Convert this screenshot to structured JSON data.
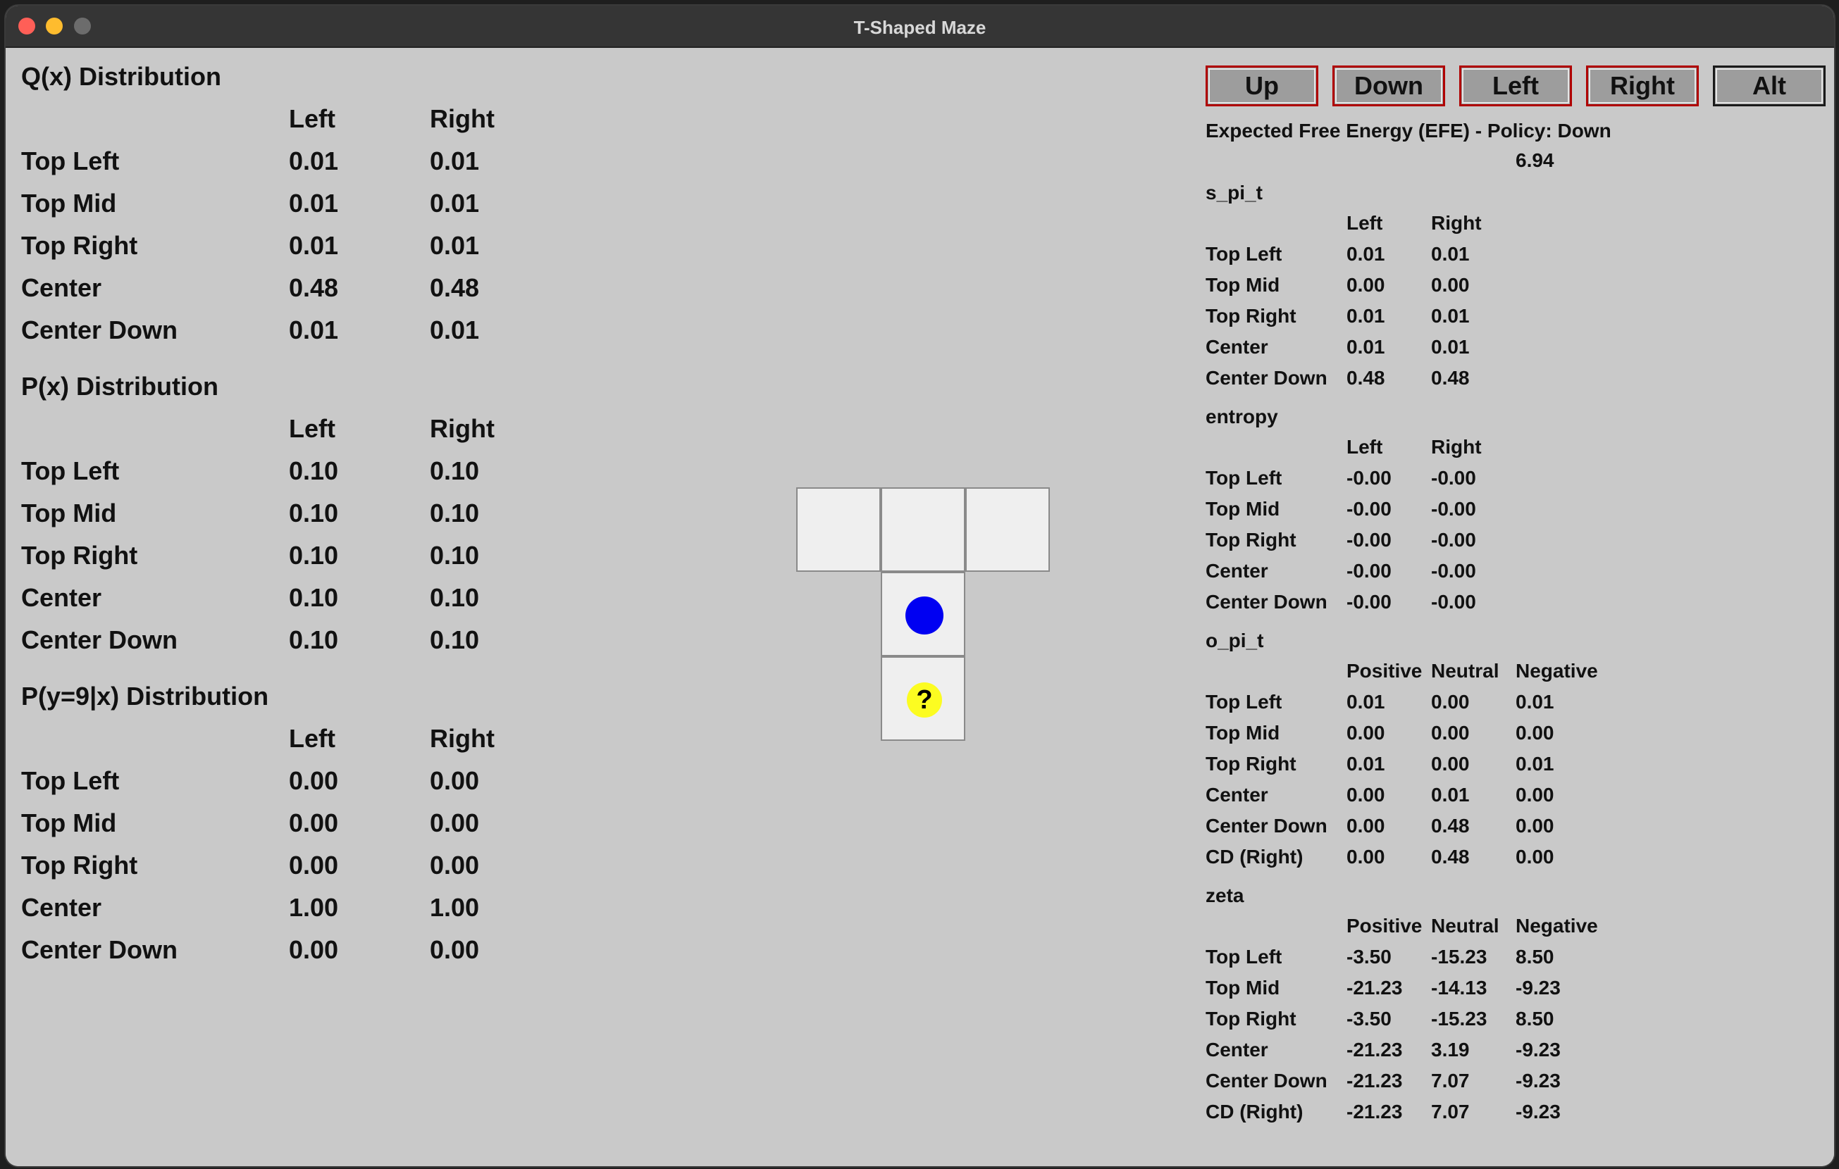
{
  "window": {
    "title": "T-Shaped Maze"
  },
  "left": {
    "tables": [
      {
        "title": "Q(x) Distribution",
        "headers": [
          "Left",
          "Right"
        ],
        "rows": [
          {
            "label": "Top Left",
            "left": "0.01",
            "right": "0.01"
          },
          {
            "label": "Top Mid",
            "left": "0.01",
            "right": "0.01"
          },
          {
            "label": "Top Right",
            "left": "0.01",
            "right": "0.01"
          },
          {
            "label": "Center",
            "left": "0.48",
            "right": "0.48"
          },
          {
            "label": "Center Down",
            "left": "0.01",
            "right": "0.01"
          }
        ]
      },
      {
        "title": "P(x) Distribution",
        "headers": [
          "Left",
          "Right"
        ],
        "rows": [
          {
            "label": "Top Left",
            "left": "0.10",
            "right": "0.10"
          },
          {
            "label": "Top Mid",
            "left": "0.10",
            "right": "0.10"
          },
          {
            "label": "Top Right",
            "left": "0.10",
            "right": "0.10"
          },
          {
            "label": "Center",
            "left": "0.10",
            "right": "0.10"
          },
          {
            "label": "Center Down",
            "left": "0.10",
            "right": "0.10"
          }
        ]
      },
      {
        "title": "P(y=9|x) Distribution",
        "headers": [
          "Left",
          "Right"
        ],
        "rows": [
          {
            "label": "Top Left",
            "left": "0.00",
            "right": "0.00"
          },
          {
            "label": "Top Mid",
            "left": "0.00",
            "right": "0.00"
          },
          {
            "label": "Top Right",
            "left": "0.00",
            "right": "0.00"
          },
          {
            "label": "Center",
            "left": "1.00",
            "right": "1.00"
          },
          {
            "label": "Center Down",
            "left": "0.00",
            "right": "0.00"
          }
        ]
      }
    ]
  },
  "maze": {
    "unknown_marker": "?"
  },
  "buttons": [
    "Up",
    "Down",
    "Left",
    "Right",
    "Alt"
  ],
  "right": {
    "efe_title": "Expected Free Energy (EFE) - Policy: Down",
    "efe_value": "6.94",
    "sections": [
      {
        "title": "s_pi_t",
        "headers": [
          "Left",
          "Right"
        ],
        "rows": [
          {
            "label": "Top Left",
            "vals": [
              "0.01",
              "0.01"
            ]
          },
          {
            "label": "Top Mid",
            "vals": [
              "0.00",
              "0.00"
            ]
          },
          {
            "label": "Top Right",
            "vals": [
              "0.01",
              "0.01"
            ]
          },
          {
            "label": "Center",
            "vals": [
              "0.01",
              "0.01"
            ]
          },
          {
            "label": "Center Down",
            "vals": [
              "0.48",
              "0.48"
            ]
          }
        ]
      },
      {
        "title": "entropy",
        "headers": [
          "Left",
          "Right"
        ],
        "rows": [
          {
            "label": "Top Left",
            "vals": [
              "-0.00",
              "-0.00"
            ]
          },
          {
            "label": "Top Mid",
            "vals": [
              "-0.00",
              "-0.00"
            ]
          },
          {
            "label": "Top Right",
            "vals": [
              "-0.00",
              "-0.00"
            ]
          },
          {
            "label": "Center",
            "vals": [
              "-0.00",
              "-0.00"
            ]
          },
          {
            "label": "Center Down",
            "vals": [
              "-0.00",
              "-0.00"
            ]
          }
        ]
      },
      {
        "title": "o_pi_t",
        "headers": [
          "Positive",
          "Neutral",
          "Negative"
        ],
        "rows": [
          {
            "label": "Top Left",
            "vals": [
              "0.01",
              "0.00",
              "0.01"
            ]
          },
          {
            "label": "Top Mid",
            "vals": [
              "0.00",
              "0.00",
              "0.00"
            ]
          },
          {
            "label": "Top Right",
            "vals": [
              "0.01",
              "0.00",
              "0.01"
            ]
          },
          {
            "label": "Center",
            "vals": [
              "0.00",
              "0.01",
              "0.00"
            ]
          },
          {
            "label": "Center Down",
            "vals": [
              "0.00",
              "0.48",
              "0.00"
            ]
          },
          {
            "label": "CD (Right)",
            "vals": [
              "0.00",
              "0.48",
              "0.00"
            ]
          }
        ]
      },
      {
        "title": "zeta",
        "headers": [
          "Positive",
          "Neutral",
          "Negative"
        ],
        "rows": [
          {
            "label": "Top Left",
            "vals": [
              "-3.50",
              "-15.23",
              "8.50"
            ]
          },
          {
            "label": "Top Mid",
            "vals": [
              "-21.23",
              "-14.13",
              "-9.23"
            ]
          },
          {
            "label": "Top Right",
            "vals": [
              "-3.50",
              "-15.23",
              "8.50"
            ]
          },
          {
            "label": "Center",
            "vals": [
              "-21.23",
              "3.19",
              "-9.23"
            ]
          },
          {
            "label": "Center Down",
            "vals": [
              "-21.23",
              "7.07",
              "-9.23"
            ]
          },
          {
            "label": "CD (Right)",
            "vals": [
              "-21.23",
              "7.07",
              "-9.23"
            ]
          }
        ]
      }
    ]
  }
}
